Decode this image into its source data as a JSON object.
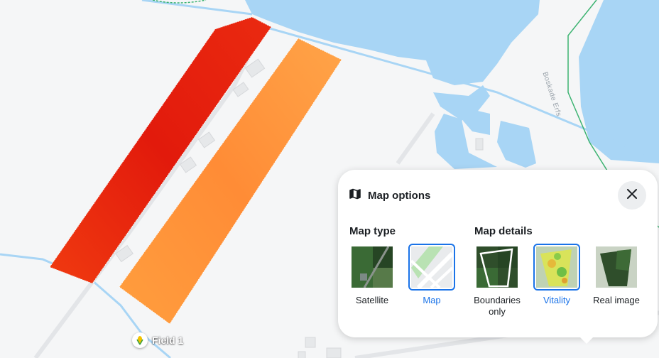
{
  "map": {
    "field_name": "Field 1",
    "street_name": "Boskade Erfs"
  },
  "panel": {
    "title": "Map options",
    "map_type": {
      "title": "Map type",
      "options": [
        {
          "label": "Satellite",
          "selected": false
        },
        {
          "label": "Map",
          "selected": true
        }
      ]
    },
    "map_details": {
      "title": "Map details",
      "options": [
        {
          "label": "Boundaries only",
          "selected": false
        },
        {
          "label": "Vitality",
          "selected": true
        },
        {
          "label": "Real image",
          "selected": false
        }
      ]
    }
  },
  "colors": {
    "accent": "#1a73e8",
    "water": "#a8d5f5",
    "field_red": "#e8260f",
    "field_orange": "#ff9a3c"
  }
}
